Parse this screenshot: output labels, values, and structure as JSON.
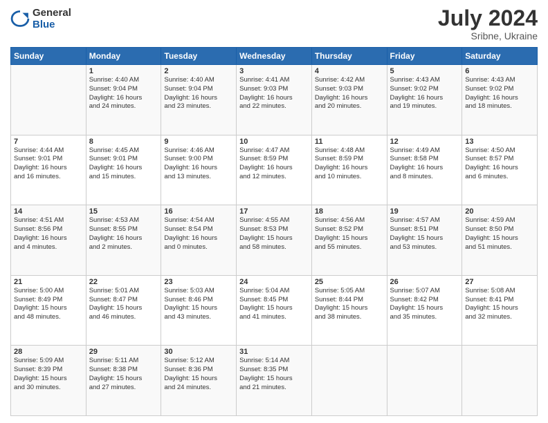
{
  "logo": {
    "general": "General",
    "blue": "Blue"
  },
  "header": {
    "month_year": "July 2024",
    "location": "Sribne, Ukraine"
  },
  "weekdays": [
    "Sunday",
    "Monday",
    "Tuesday",
    "Wednesday",
    "Thursday",
    "Friday",
    "Saturday"
  ],
  "weeks": [
    [
      {
        "day": "",
        "info": ""
      },
      {
        "day": "1",
        "info": "Sunrise: 4:40 AM\nSunset: 9:04 PM\nDaylight: 16 hours\nand 24 minutes."
      },
      {
        "day": "2",
        "info": "Sunrise: 4:40 AM\nSunset: 9:04 PM\nDaylight: 16 hours\nand 23 minutes."
      },
      {
        "day": "3",
        "info": "Sunrise: 4:41 AM\nSunset: 9:03 PM\nDaylight: 16 hours\nand 22 minutes."
      },
      {
        "day": "4",
        "info": "Sunrise: 4:42 AM\nSunset: 9:03 PM\nDaylight: 16 hours\nand 20 minutes."
      },
      {
        "day": "5",
        "info": "Sunrise: 4:43 AM\nSunset: 9:02 PM\nDaylight: 16 hours\nand 19 minutes."
      },
      {
        "day": "6",
        "info": "Sunrise: 4:43 AM\nSunset: 9:02 PM\nDaylight: 16 hours\nand 18 minutes."
      }
    ],
    [
      {
        "day": "7",
        "info": "Sunrise: 4:44 AM\nSunset: 9:01 PM\nDaylight: 16 hours\nand 16 minutes."
      },
      {
        "day": "8",
        "info": "Sunrise: 4:45 AM\nSunset: 9:01 PM\nDaylight: 16 hours\nand 15 minutes."
      },
      {
        "day": "9",
        "info": "Sunrise: 4:46 AM\nSunset: 9:00 PM\nDaylight: 16 hours\nand 13 minutes."
      },
      {
        "day": "10",
        "info": "Sunrise: 4:47 AM\nSunset: 8:59 PM\nDaylight: 16 hours\nand 12 minutes."
      },
      {
        "day": "11",
        "info": "Sunrise: 4:48 AM\nSunset: 8:59 PM\nDaylight: 16 hours\nand 10 minutes."
      },
      {
        "day": "12",
        "info": "Sunrise: 4:49 AM\nSunset: 8:58 PM\nDaylight: 16 hours\nand 8 minutes."
      },
      {
        "day": "13",
        "info": "Sunrise: 4:50 AM\nSunset: 8:57 PM\nDaylight: 16 hours\nand 6 minutes."
      }
    ],
    [
      {
        "day": "14",
        "info": "Sunrise: 4:51 AM\nSunset: 8:56 PM\nDaylight: 16 hours\nand 4 minutes."
      },
      {
        "day": "15",
        "info": "Sunrise: 4:53 AM\nSunset: 8:55 PM\nDaylight: 16 hours\nand 2 minutes."
      },
      {
        "day": "16",
        "info": "Sunrise: 4:54 AM\nSunset: 8:54 PM\nDaylight: 16 hours\nand 0 minutes."
      },
      {
        "day": "17",
        "info": "Sunrise: 4:55 AM\nSunset: 8:53 PM\nDaylight: 15 hours\nand 58 minutes."
      },
      {
        "day": "18",
        "info": "Sunrise: 4:56 AM\nSunset: 8:52 PM\nDaylight: 15 hours\nand 55 minutes."
      },
      {
        "day": "19",
        "info": "Sunrise: 4:57 AM\nSunset: 8:51 PM\nDaylight: 15 hours\nand 53 minutes."
      },
      {
        "day": "20",
        "info": "Sunrise: 4:59 AM\nSunset: 8:50 PM\nDaylight: 15 hours\nand 51 minutes."
      }
    ],
    [
      {
        "day": "21",
        "info": "Sunrise: 5:00 AM\nSunset: 8:49 PM\nDaylight: 15 hours\nand 48 minutes."
      },
      {
        "day": "22",
        "info": "Sunrise: 5:01 AM\nSunset: 8:47 PM\nDaylight: 15 hours\nand 46 minutes."
      },
      {
        "day": "23",
        "info": "Sunrise: 5:03 AM\nSunset: 8:46 PM\nDaylight: 15 hours\nand 43 minutes."
      },
      {
        "day": "24",
        "info": "Sunrise: 5:04 AM\nSunset: 8:45 PM\nDaylight: 15 hours\nand 41 minutes."
      },
      {
        "day": "25",
        "info": "Sunrise: 5:05 AM\nSunset: 8:44 PM\nDaylight: 15 hours\nand 38 minutes."
      },
      {
        "day": "26",
        "info": "Sunrise: 5:07 AM\nSunset: 8:42 PM\nDaylight: 15 hours\nand 35 minutes."
      },
      {
        "day": "27",
        "info": "Sunrise: 5:08 AM\nSunset: 8:41 PM\nDaylight: 15 hours\nand 32 minutes."
      }
    ],
    [
      {
        "day": "28",
        "info": "Sunrise: 5:09 AM\nSunset: 8:39 PM\nDaylight: 15 hours\nand 30 minutes."
      },
      {
        "day": "29",
        "info": "Sunrise: 5:11 AM\nSunset: 8:38 PM\nDaylight: 15 hours\nand 27 minutes."
      },
      {
        "day": "30",
        "info": "Sunrise: 5:12 AM\nSunset: 8:36 PM\nDaylight: 15 hours\nand 24 minutes."
      },
      {
        "day": "31",
        "info": "Sunrise: 5:14 AM\nSunset: 8:35 PM\nDaylight: 15 hours\nand 21 minutes."
      },
      {
        "day": "",
        "info": ""
      },
      {
        "day": "",
        "info": ""
      },
      {
        "day": "",
        "info": ""
      }
    ]
  ]
}
